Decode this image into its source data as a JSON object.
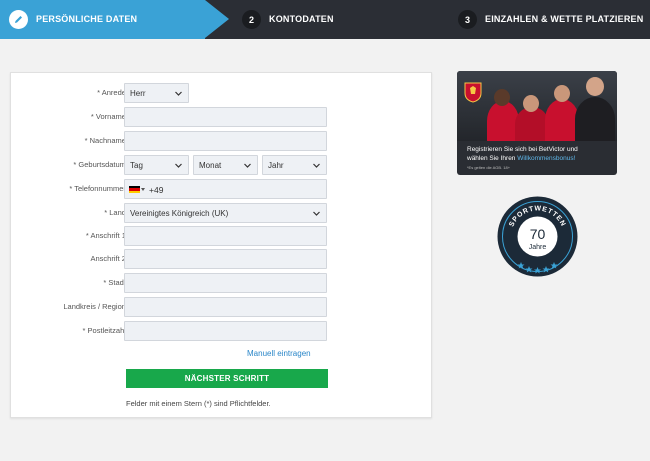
{
  "steps": [
    {
      "number": "",
      "label": "PERSÖNLICHE DATEN",
      "active": true
    },
    {
      "number": "2",
      "label": "KONTODATEN",
      "active": false
    },
    {
      "number": "3",
      "label": "EINZAHLEN & WETTE PLATZIEREN",
      "active": false
    }
  ],
  "form": {
    "salutation": {
      "label": "* Anrede:",
      "value": "Herr"
    },
    "first_name": {
      "label": "* Vorname:",
      "value": ""
    },
    "last_name": {
      "label": "* Nachname:",
      "value": ""
    },
    "birthdate": {
      "label": "* Geburtsdatum:",
      "day": "Tag",
      "month": "Monat",
      "year": "Jahr"
    },
    "phone": {
      "label": "* Telefonnummer:",
      "code": "+49"
    },
    "country": {
      "label": "* Land:",
      "value": "Vereinigtes Königreich (UK)"
    },
    "address1": {
      "label": "* Anschrift 1:",
      "value": ""
    },
    "address2": {
      "label": "Anschrift 2:",
      "value": ""
    },
    "city": {
      "label": "* Stadt:",
      "value": ""
    },
    "county": {
      "label": "Landkreis / Region:",
      "value": ""
    },
    "postcode": {
      "label": "* Postleitzahl:",
      "value": ""
    },
    "manual_link": "Manuell eintragen",
    "next_button": "NÄCHSTER SCHRITT",
    "required_note": "Felder mit einem Stern (*) sind Pflichtfelder."
  },
  "promo": {
    "text_line1": "Registrieren Sie sich bei BetVictor und",
    "text_line2": "wählen Sie Ihren",
    "text_highlight": "Willkommensbonus!",
    "small_print": "*Es gelten die AGB. 18+"
  },
  "seal": {
    "arc_text": "SPORTWETTEN",
    "number": "70",
    "word": "Jahre"
  },
  "colors": {
    "active_step": "#3aa2d6",
    "header_bg": "#2b2e35",
    "button": "#18a84b",
    "link": "#2a86c8"
  }
}
